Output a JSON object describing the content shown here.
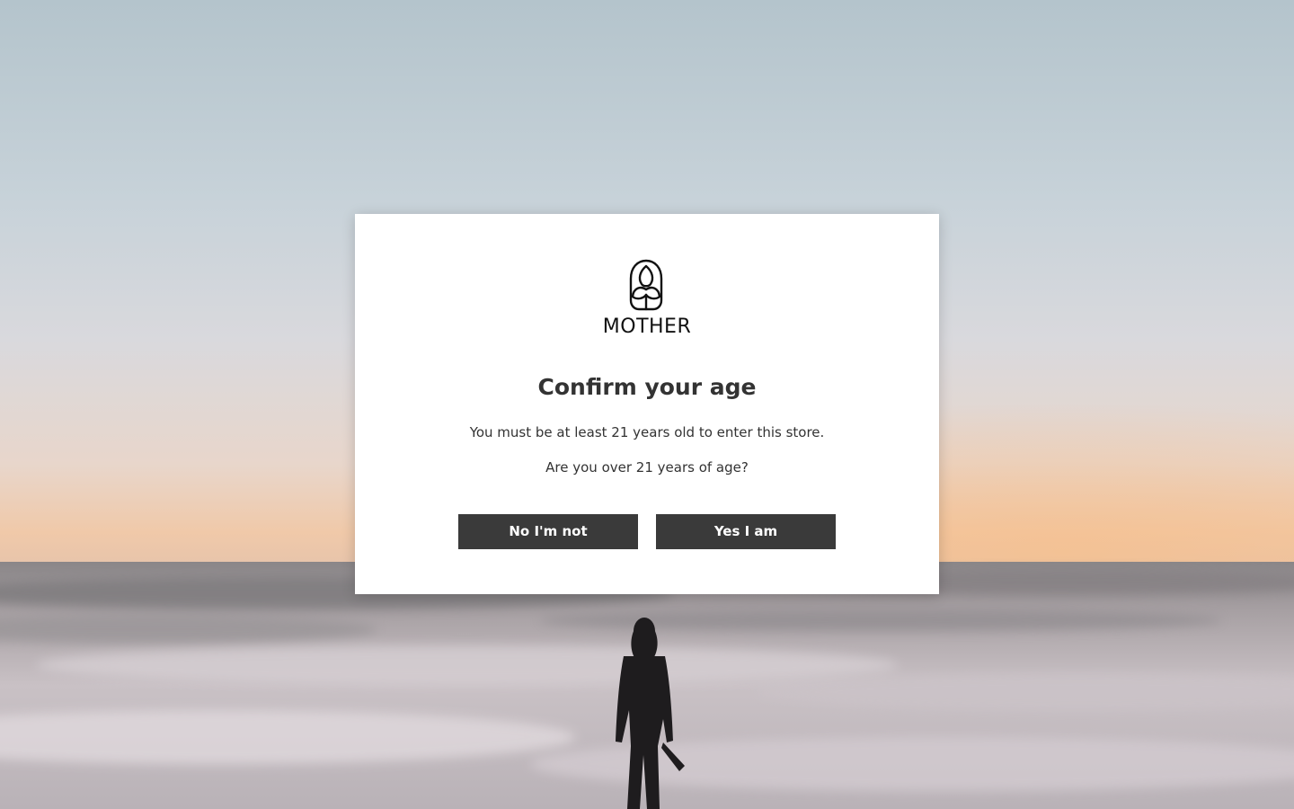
{
  "logo": {
    "icon": "mother-leaf-face-icon",
    "wordmark": "MOTHER"
  },
  "dialog": {
    "title": "Confirm your age",
    "message": "You must be at least 21 years old to enter this store.",
    "question": "Are you over 21 years of age?"
  },
  "buttons": {
    "no_label": "No I'm not",
    "yes_label": "Yes I am"
  },
  "colors": {
    "button_bg": "#3a3a3a",
    "button_text": "#ffffff",
    "text": "#333333",
    "modal_bg": "#ffffff"
  }
}
